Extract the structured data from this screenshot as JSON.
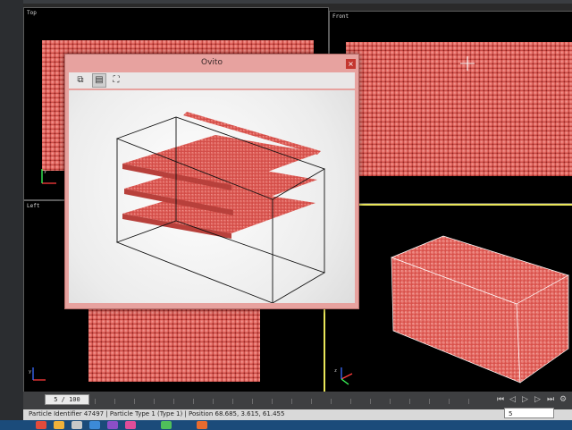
{
  "app": {
    "dialog_title": "Ovito",
    "close_glyph": "×"
  },
  "viewports": {
    "top_label": "Top",
    "front_label": "Front",
    "left_label": "Left"
  },
  "axis_labels": {
    "x": "x",
    "y": "y",
    "z": "z"
  },
  "toolbar_icons": [
    "copy-icon",
    "paste-icon",
    "fit-view-icon"
  ],
  "toolbar_glyphs": {
    "copy": "⧉",
    "paste": "▤",
    "fit": "⛶"
  },
  "timeline": {
    "frame_display": "5 / 100",
    "current_frame": 5,
    "total_frames": 100
  },
  "status": {
    "text": "Particle Identifier 47497 | Particle Type 1 (Type 1) | Position 68.685, 3.615, 61.455"
  },
  "animation": {
    "spinner_value": "5",
    "icons": [
      "jump-start-icon",
      "step-back-icon",
      "play-icon",
      "step-forward-icon",
      "jump-end-icon",
      "settings-icon"
    ],
    "glyphs": {
      "jump_start": "⏮",
      "step_back": "◁",
      "play": "▷",
      "step_forward": "▷",
      "jump_end": "⏭",
      "settings": "⚙"
    }
  },
  "colors": {
    "particle": "#d8504a",
    "active_viewport": "#e9e65a",
    "dialog_frame": "#e7a29f"
  }
}
